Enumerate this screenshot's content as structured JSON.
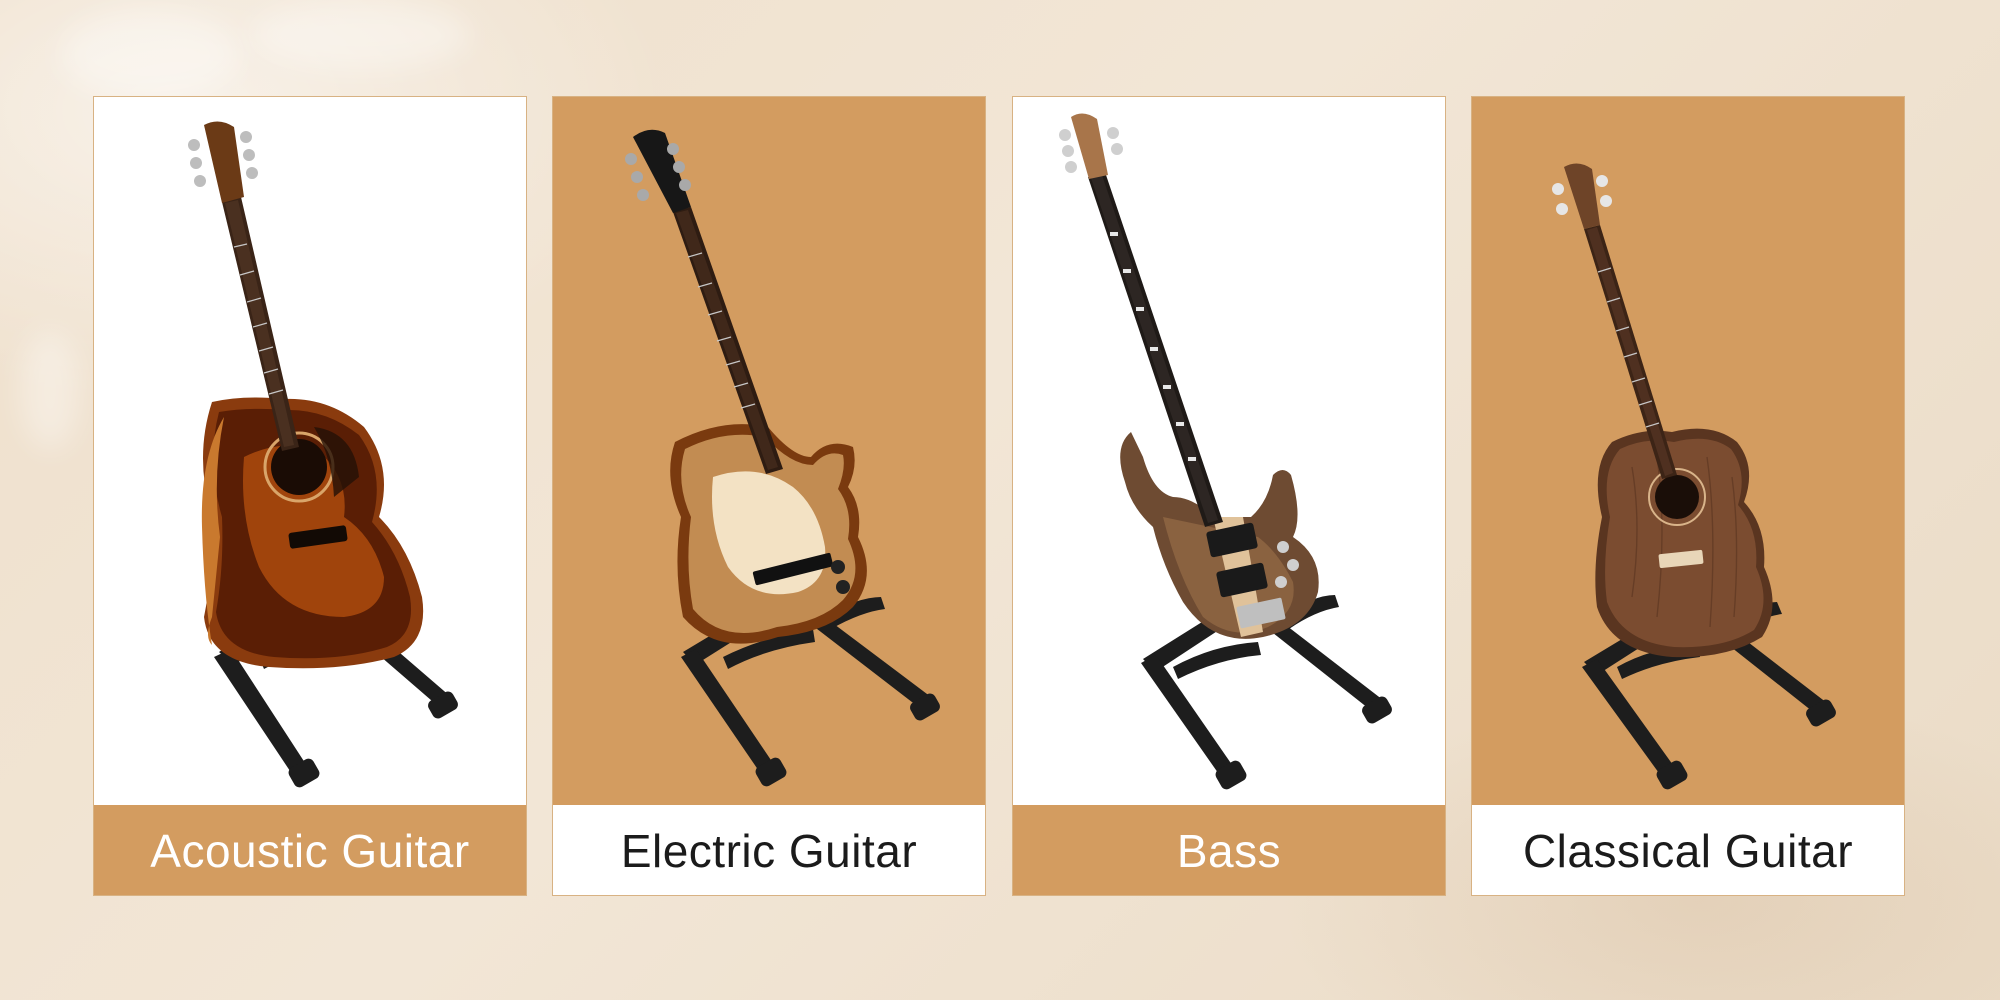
{
  "colors": {
    "accent": "#d39c60",
    "card_white": "#ffffff",
    "background": "#efe0cc"
  },
  "cards": [
    {
      "label": "Acoustic Guitar",
      "image": "acoustic-guitar-on-stand",
      "photo_bg": "white"
    },
    {
      "label": "Electric Guitar",
      "image": "electric-guitar-on-stand",
      "photo_bg": "accent"
    },
    {
      "label": "Bass",
      "image": "bass-guitar-on-stand",
      "photo_bg": "white"
    },
    {
      "label": "Classical Guitar",
      "image": "classical-guitar-on-stand",
      "photo_bg": "accent"
    }
  ]
}
